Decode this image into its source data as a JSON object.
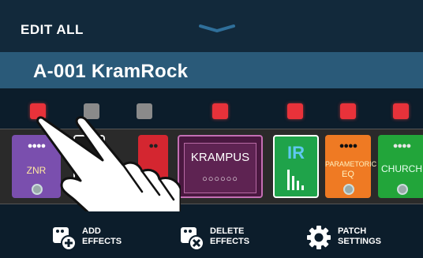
{
  "header": {
    "mode_label": "EDIT ALL"
  },
  "patch": {
    "name": "A-001 KramRock"
  },
  "effect_leds": [
    {
      "state": "on"
    },
    {
      "state": "off"
    },
    {
      "state": "off"
    },
    {
      "state": "on"
    },
    {
      "state": "on"
    },
    {
      "state": "on"
    },
    {
      "state": "on"
    }
  ],
  "effects": [
    {
      "label": "ZNR",
      "color": "#7a4fae"
    },
    {
      "label": "",
      "color": "#1a1a1a"
    },
    {
      "label": "",
      "color": "#d42630"
    },
    {
      "label": "KRAMPUS",
      "color": "#4a1840"
    },
    {
      "label": "IR",
      "color": "#1fa34a"
    },
    {
      "label_line1": "PARAMETORIC",
      "label_line2": "EQ",
      "color": "#ef7a23"
    },
    {
      "label": "CHURCH",
      "color": "#22a53a"
    }
  ],
  "bottom_bar": {
    "add_effects": "ADD\nEFFECTS",
    "delete_effects": "DELETE\nEFFECTS",
    "patch_settings": "PATCH\nSETTINGS"
  },
  "colors": {
    "led_on": "#e8323a",
    "led_off": "#8a8a8a",
    "patch_bar": "#2a5a79",
    "header": "#12293b"
  }
}
